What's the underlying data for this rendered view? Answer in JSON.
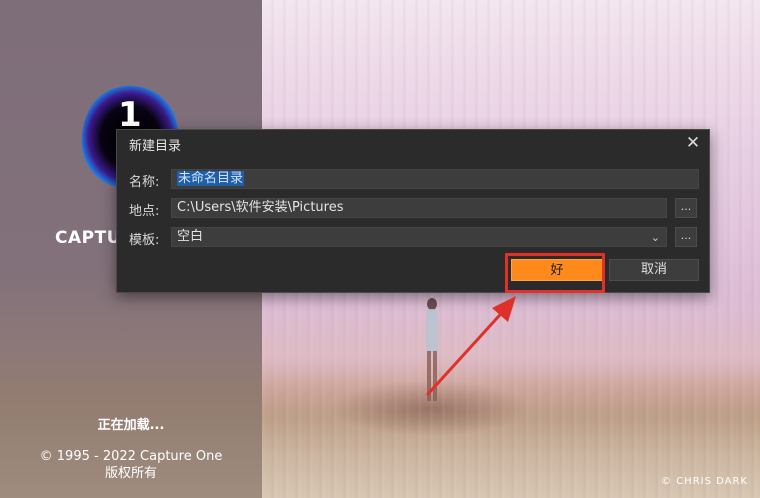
{
  "splash": {
    "brand": "CAPTURE ONE",
    "loading_text": "正在加载...",
    "copyright_line1": "© 1995 - 2022 Capture One",
    "copyright_line2": "版权所有",
    "photo_credit": "© CHRIS DARK"
  },
  "dialog": {
    "title": "新建目录",
    "close_glyph": "✕",
    "name_label": "名称:",
    "name_value": "未命名目录",
    "location_label": "地点:",
    "location_value": "C:\\Users\\软件安装\\Pictures",
    "template_label": "模板:",
    "template_value": "空白",
    "browse_label": "...",
    "ok_label": "好",
    "cancel_label": "取消"
  },
  "colors": {
    "accent": "#ff8a1c",
    "annotation": "#e0302a",
    "dialog_bg": "#2b2b2b",
    "selection": "#1f5fa8"
  },
  "icons": [
    "capture-one-logo",
    "close-icon",
    "chevron-down-icon"
  ]
}
